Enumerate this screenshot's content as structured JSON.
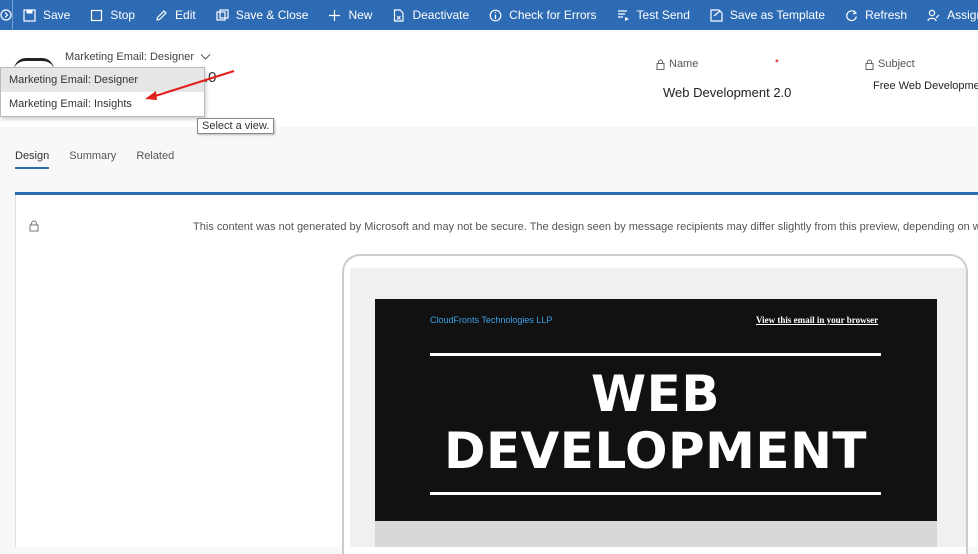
{
  "commands": [
    {
      "label": "Save",
      "icon": "save-icon"
    },
    {
      "label": "Stop",
      "icon": "stop-icon"
    },
    {
      "label": "Edit",
      "icon": "edit-icon"
    },
    {
      "label": "Save & Close",
      "icon": "save-close-icon"
    },
    {
      "label": "New",
      "icon": "plus-icon"
    },
    {
      "label": "Deactivate",
      "icon": "deactivate-icon"
    },
    {
      "label": "Check for Errors",
      "icon": "info-icon"
    },
    {
      "label": "Test Send",
      "icon": "test-send-icon"
    },
    {
      "label": "Save as Template",
      "icon": "save-template-icon"
    },
    {
      "label": "Refresh",
      "icon": "refresh-icon"
    },
    {
      "label": "Assign",
      "icon": "assign-icon"
    }
  ],
  "header": {
    "view_selector": "Marketing Email: Designer",
    "title_fragment": ".0",
    "name_label": "Name",
    "name_required": "*",
    "name_value": "Web Development 2.0",
    "subject_label": "Subject",
    "subject_value": "Free Web Developmen"
  },
  "dropdown": {
    "items": [
      "Marketing Email: Designer",
      "Marketing Email: Insights"
    ],
    "tooltip": "Select a view."
  },
  "tabs": [
    "Design",
    "Summary",
    "Related"
  ],
  "content": {
    "disclaimer": "This content was not generated by Microsoft and may not be secure. The design seen by message recipients may differ slightly from this preview, depending on which em",
    "company": "CloudFronts Technologies LLP",
    "browser_link": "View this email in your browser",
    "hero_line1": "WEB",
    "hero_line2": "DEVELOPMENT"
  },
  "colors": {
    "command_bar": "#2e6bb5",
    "accent": "#2e6bb5",
    "annotation_arrow": "#e0201b"
  }
}
